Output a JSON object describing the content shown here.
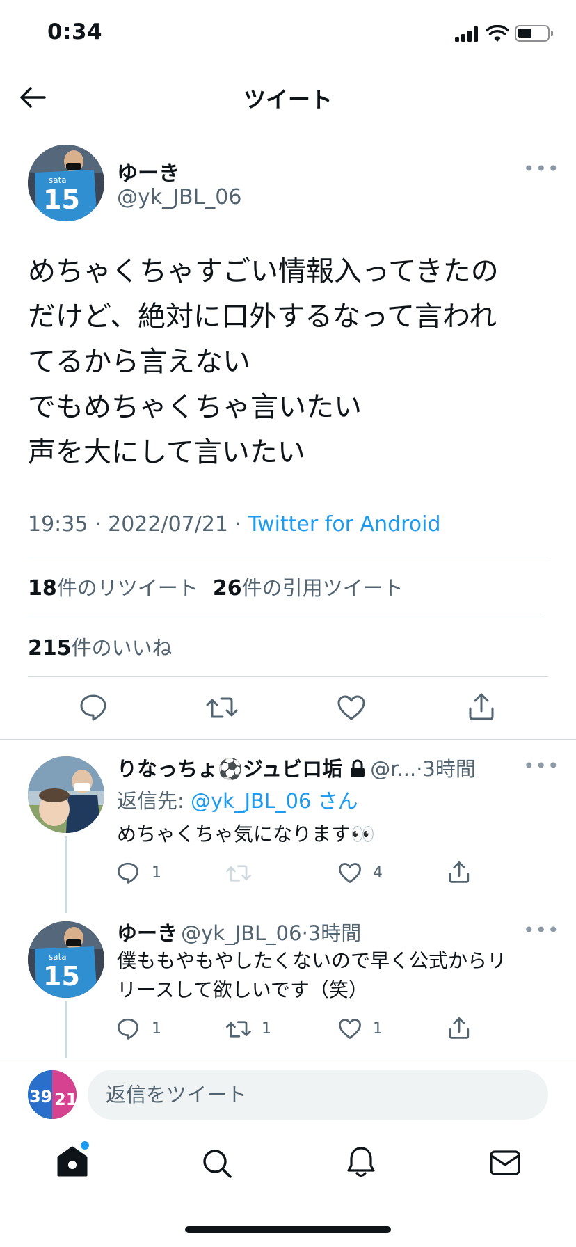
{
  "status_bar": {
    "time": "0:34"
  },
  "header": {
    "title": "ツイート"
  },
  "main_tweet": {
    "display_name": "ゆーき",
    "handle": "@yk_JBL_06",
    "text": "めちゃくちゃすごい情報入ってきたの\nだけど、絶対に口外するなって言われ\nてるから言えない\nでもめちゃくちゃ言いたい\n声を大にして言いたい",
    "time": "19:35",
    "date": "2022/07/21",
    "separator": "·",
    "source": "Twitter for Android",
    "retweets_count": "18",
    "retweets_label": "件のリツイート",
    "quotes_count": "26",
    "quotes_label": "件の引用ツイート",
    "likes_count": "215",
    "likes_label": "件のいいね"
  },
  "replies": [
    {
      "display_name": "りなっちょ⚽️ジュビロ垢",
      "handle": "@r...",
      "time": "3時間",
      "replying_to_prefix": "返信先: ",
      "replying_to_handle": "@yk_JBL_06",
      "replying_to_suffix": " さん",
      "text": "めちゃくちゃ気になります👀",
      "reply_count": "1",
      "retweet_count": "",
      "like_count": "4"
    },
    {
      "display_name": "ゆーき",
      "handle": "@yk_JBL_06",
      "time": "3時間",
      "text": "僕ももやもやしたくないので早く公式からリ\nリースして欲しいです（笑）",
      "reply_count": "1",
      "retweet_count": "1",
      "like_count": "1"
    }
  ],
  "reply_bar": {
    "placeholder": "返信をツイート"
  },
  "tab_bar": {
    "items": [
      "home",
      "search",
      "notifications",
      "messages"
    ]
  },
  "colors": {
    "accent": "#1d9bf0",
    "secondary_text": "#536471",
    "divider": "#cfd9de"
  }
}
